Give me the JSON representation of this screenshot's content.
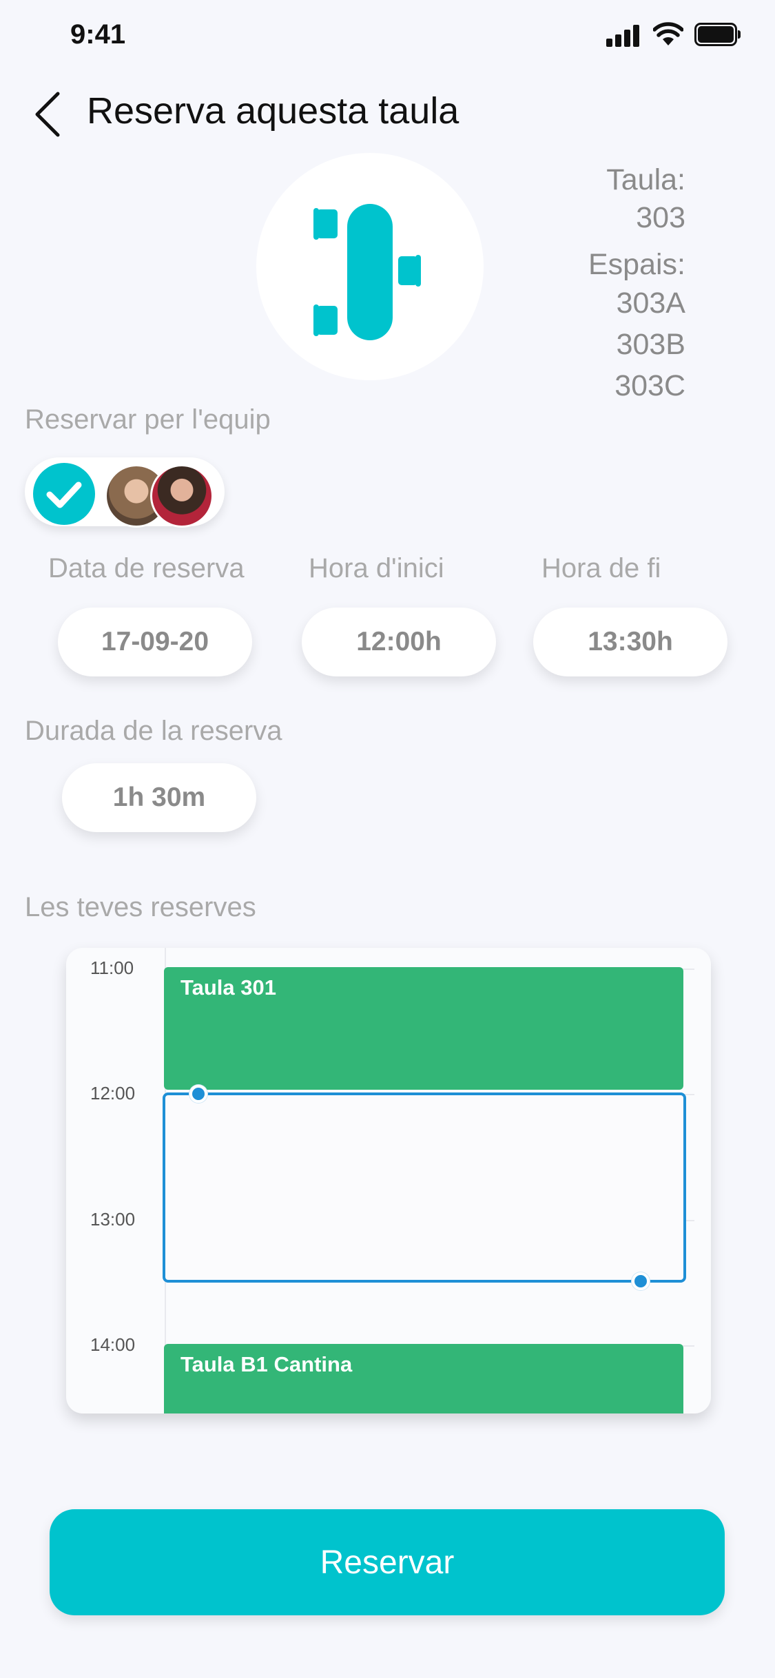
{
  "status_bar": {
    "time": "9:41"
  },
  "header": {
    "title": "Reserva aquesta taula"
  },
  "table_info": {
    "table_label": "Taula:",
    "table_number": "303",
    "spaces_label": "Espais:",
    "spaces": [
      "303A",
      "303B",
      "303C"
    ]
  },
  "team": {
    "label": "Reservar per l'equip",
    "checked": true
  },
  "booking": {
    "date_label": "Data de reserva",
    "date_value": "17-09-20",
    "start_label": "Hora d'inici",
    "start_value": "12:00h",
    "end_label": "Hora de fi",
    "end_value": "13:30h"
  },
  "duration": {
    "label": "Durada de la reserva",
    "value": "1h 30m"
  },
  "calendar": {
    "label": "Les teves reserves",
    "hours": [
      "11:00",
      "12:00",
      "13:00",
      "14:00"
    ],
    "events": [
      {
        "name": "Taula 301",
        "start": "11:00",
        "end": "12:00"
      },
      {
        "name": "Taula B1 Cantina",
        "start": "14:00",
        "end": ""
      }
    ],
    "selection": {
      "start": "12:00",
      "end": "13:30"
    }
  },
  "actions": {
    "reserve_label": "Reservar"
  },
  "colors": {
    "accent": "#00c3cd",
    "event": "#33b677",
    "selection": "#1e8fd6",
    "background": "#f6f7fc"
  }
}
